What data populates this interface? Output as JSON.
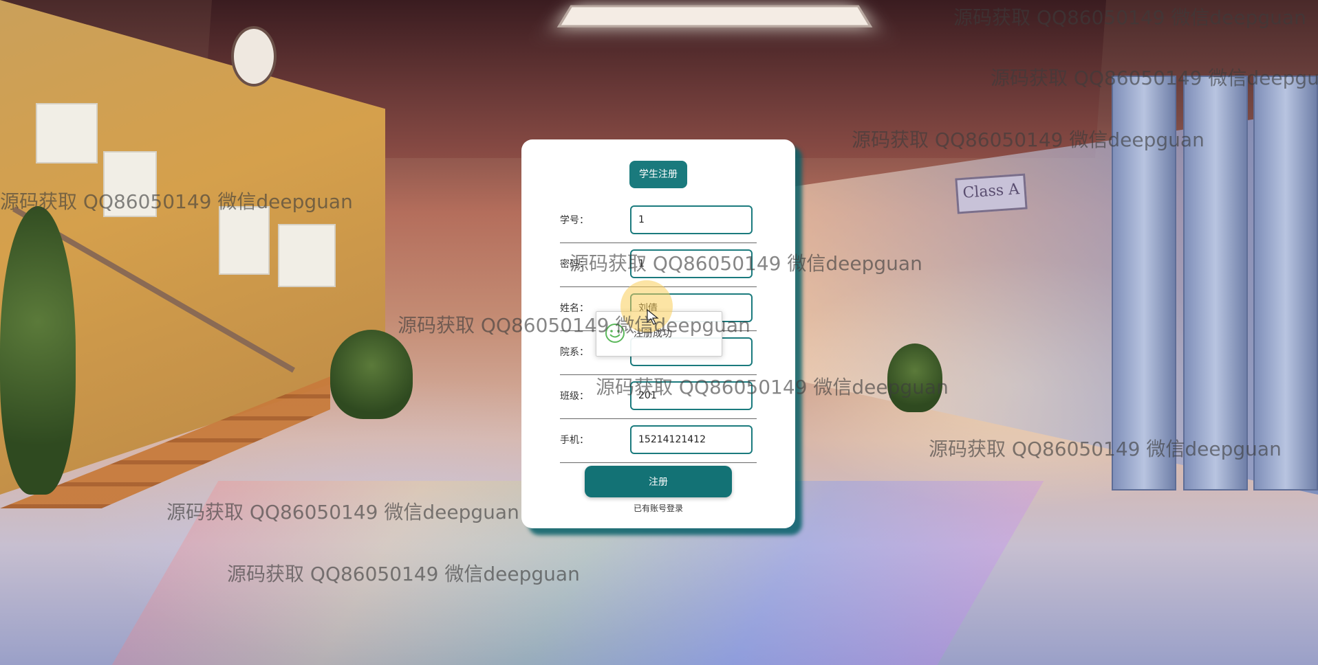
{
  "form": {
    "title": "学生注册",
    "fields": [
      {
        "label": "学号：",
        "value": "1"
      },
      {
        "label": "密码：",
        "value": "1"
      },
      {
        "label": "姓名：",
        "value": "刘倩"
      },
      {
        "label": "院系：",
        "value": ""
      },
      {
        "label": "班级：",
        "value": "201"
      },
      {
        "label": "手机：",
        "value": "15214121412"
      }
    ],
    "submit_label": "注册",
    "login_link": "已有账号登录"
  },
  "toast": {
    "message": "注册成功",
    "icon": "smile-icon"
  },
  "scene": {
    "class_sign": "Class A"
  },
  "watermark": {
    "text": "源码获取 QQ86050149 微信deepguan"
  },
  "colors": {
    "accent": "#1a7a7d",
    "button": "#137275",
    "card_shadow": "#086068"
  }
}
